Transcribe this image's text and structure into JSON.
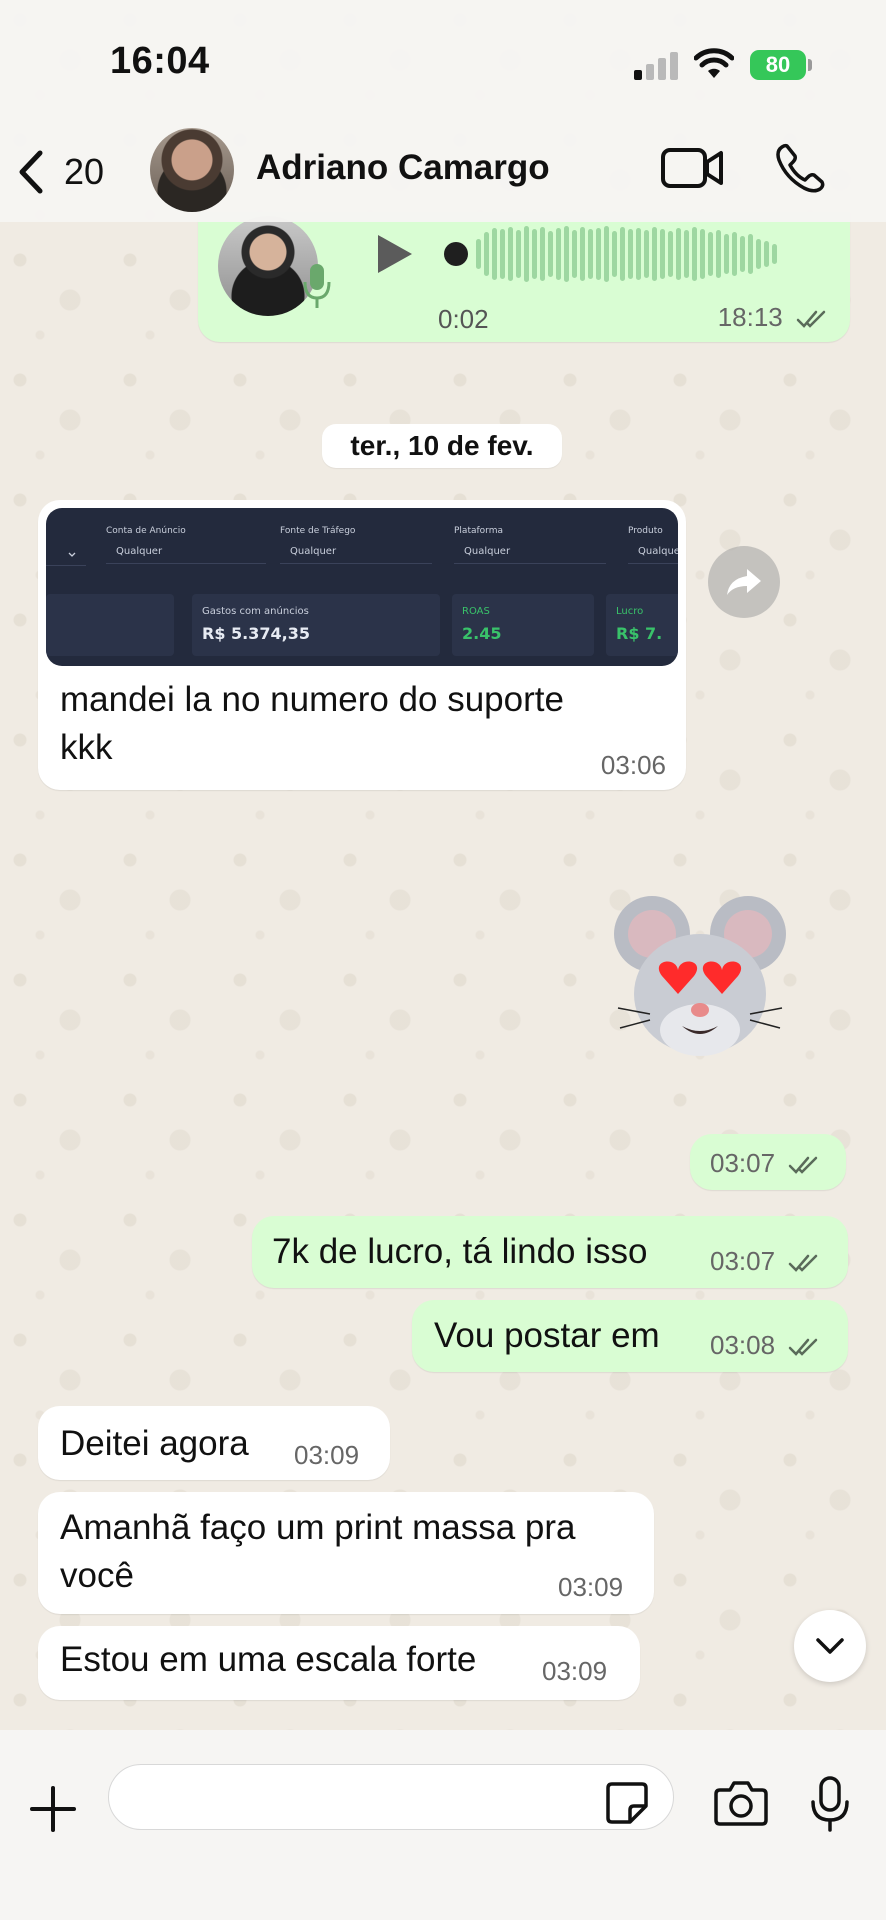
{
  "status_bar": {
    "time": "16:04",
    "battery": "80"
  },
  "header": {
    "back_count": "20",
    "contact_name": "Adriano Camargo"
  },
  "messages": {
    "audio": {
      "duration": "0:02",
      "time": "18:13"
    },
    "date_divider": "ter., 10 de fev.",
    "image_message": {
      "dashboard": {
        "filters": [
          {
            "label": "Conta de Anúncio",
            "value": "Qualquer"
          },
          {
            "label": "Fonte de Tráfego",
            "value": "Qualquer"
          },
          {
            "label": "Plataforma",
            "value": "Qualquer"
          },
          {
            "label": "Produto",
            "value": "Qualquer"
          }
        ],
        "cards": [
          {
            "title": "Gastos com anúncios",
            "value": "R$ 5.374,35"
          },
          {
            "title": "ROAS",
            "value": "2.45"
          },
          {
            "title": "Lucro",
            "value": "R$ 7."
          }
        ]
      },
      "caption": "mandei la no numero do suporte kkk",
      "time": "03:06"
    },
    "sticker_time": "03:07",
    "out_1": {
      "text": "7k de lucro, tá lindo isso",
      "time": "03:07"
    },
    "out_2": {
      "text": "Vou postar em",
      "time": "03:08"
    },
    "in_1": {
      "text": "Deitei agora",
      "time": "03:09"
    },
    "in_2": {
      "text": "Amanhã faço um print massa pra você",
      "time": "03:09"
    },
    "in_3": {
      "text": "Estou em uma escala forte",
      "time": "03:09"
    }
  },
  "composer": {
    "placeholder": ""
  },
  "colors": {
    "outgoing_bubble": "#d9fdd3",
    "incoming_bubble": "#ffffff",
    "battery": "#35c759",
    "wallpaper": "#efeae2"
  },
  "icons": [
    "back-chevron-icon",
    "video-call-icon",
    "phone-icon",
    "play-icon",
    "microphone-icon",
    "forward-icon",
    "chevron-down-icon",
    "plus-icon",
    "sticker-icon",
    "camera-icon",
    "double-check-icon"
  ]
}
